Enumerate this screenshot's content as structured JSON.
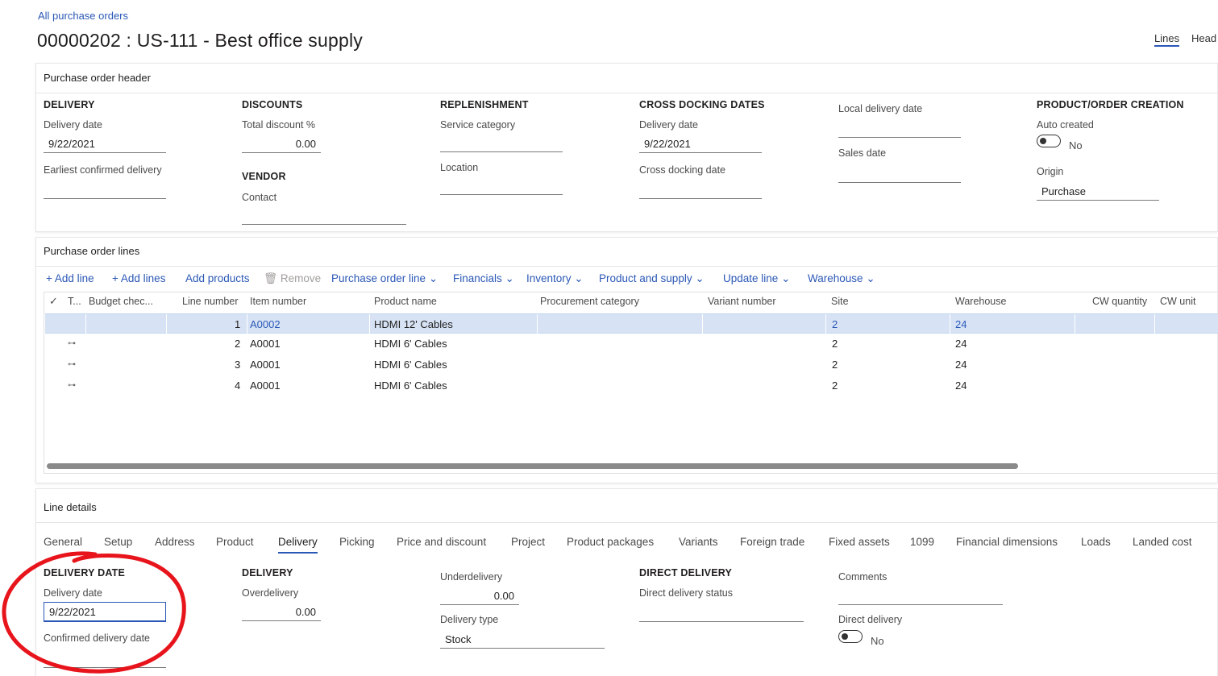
{
  "breadcrumb": "All purchase orders",
  "title": "00000202 : US-111 - Best office supply",
  "topnav": {
    "lines": "Lines",
    "header": "Head"
  },
  "header_section": {
    "title": "Purchase order header",
    "delivery": {
      "group": "DELIVERY",
      "delivery_date_label": "Delivery date",
      "delivery_date": "9/22/2021",
      "earliest_label": "Earliest confirmed delivery"
    },
    "discounts": {
      "group": "DISCOUNTS",
      "total_discount_label": "Total discount %",
      "total_discount": "0.00"
    },
    "vendor": {
      "group": "VENDOR",
      "contact_label": "Contact"
    },
    "replenishment": {
      "group": "REPLENISHMENT",
      "service_category_label": "Service category",
      "location_label": "Location"
    },
    "cross_docking": {
      "group": "CROSS DOCKING DATES",
      "delivery_date_label": "Delivery date",
      "delivery_date": "9/22/2021",
      "cross_docking_label": "Cross docking date"
    },
    "local": {
      "local_delivery_label": "Local delivery date",
      "sales_date_label": "Sales date"
    },
    "product_order": {
      "group": "PRODUCT/ORDER CREATION",
      "auto_created_label": "Auto created",
      "auto_created": "No",
      "origin_label": "Origin",
      "origin": "Purchase"
    }
  },
  "lines_section": {
    "title": "Purchase order lines",
    "toolbar": {
      "add_line": "Add line",
      "add_lines": "Add lines",
      "add_products": "Add products",
      "remove": "Remove",
      "purchase_order_line": "Purchase order line",
      "financials": "Financials",
      "inventory": "Inventory",
      "product_and_supply": "Product and supply",
      "update_line": "Update line",
      "warehouse": "Warehouse"
    },
    "columns": [
      "T...",
      "Budget chec...",
      "Line number",
      "Item number",
      "Product name",
      "Procurement category",
      "Variant number",
      "Site",
      "Warehouse",
      "CW quantity",
      "CW unit"
    ],
    "rows": [
      {
        "line": "1",
        "item": "A0002",
        "product": "HDMI 12' Cables",
        "site": "2",
        "warehouse": "24"
      },
      {
        "line": "2",
        "item": "A0001",
        "product": "HDMI 6' Cables",
        "site": "2",
        "warehouse": "24"
      },
      {
        "line": "3",
        "item": "A0001",
        "product": "HDMI 6' Cables",
        "site": "2",
        "warehouse": "24"
      },
      {
        "line": "4",
        "item": "A0001",
        "product": "HDMI 6' Cables",
        "site": "2",
        "warehouse": "24"
      }
    ]
  },
  "line_details": {
    "title": "Line details",
    "tabs": [
      "General",
      "Setup",
      "Address",
      "Product",
      "Delivery",
      "Picking",
      "Price and discount",
      "Project",
      "Product packages",
      "Variants",
      "Foreign trade",
      "Fixed assets",
      "1099",
      "Financial dimensions",
      "Loads",
      "Landed cost"
    ],
    "active_tab": "Delivery",
    "delivery_date_group": {
      "group": "DELIVERY DATE",
      "delivery_date_label": "Delivery date",
      "delivery_date": "9/22/2021",
      "confirmed_label": "Confirmed delivery date"
    },
    "delivery_group": {
      "group": "DELIVERY",
      "overdelivery_label": "Overdelivery",
      "overdelivery": "0.00"
    },
    "under": {
      "underdelivery_label": "Underdelivery",
      "underdelivery": "0.00",
      "delivery_type_label": "Delivery type",
      "delivery_type": "Stock"
    },
    "direct": {
      "group": "DIRECT DELIVERY",
      "status_label": "Direct delivery status"
    },
    "comments": {
      "comments_label": "Comments",
      "direct_delivery_label": "Direct delivery",
      "direct_delivery": "No"
    }
  },
  "colors": {
    "link": "#2b58b6",
    "selected_row": "#d7e3f5",
    "annotation": "#e8141c"
  }
}
